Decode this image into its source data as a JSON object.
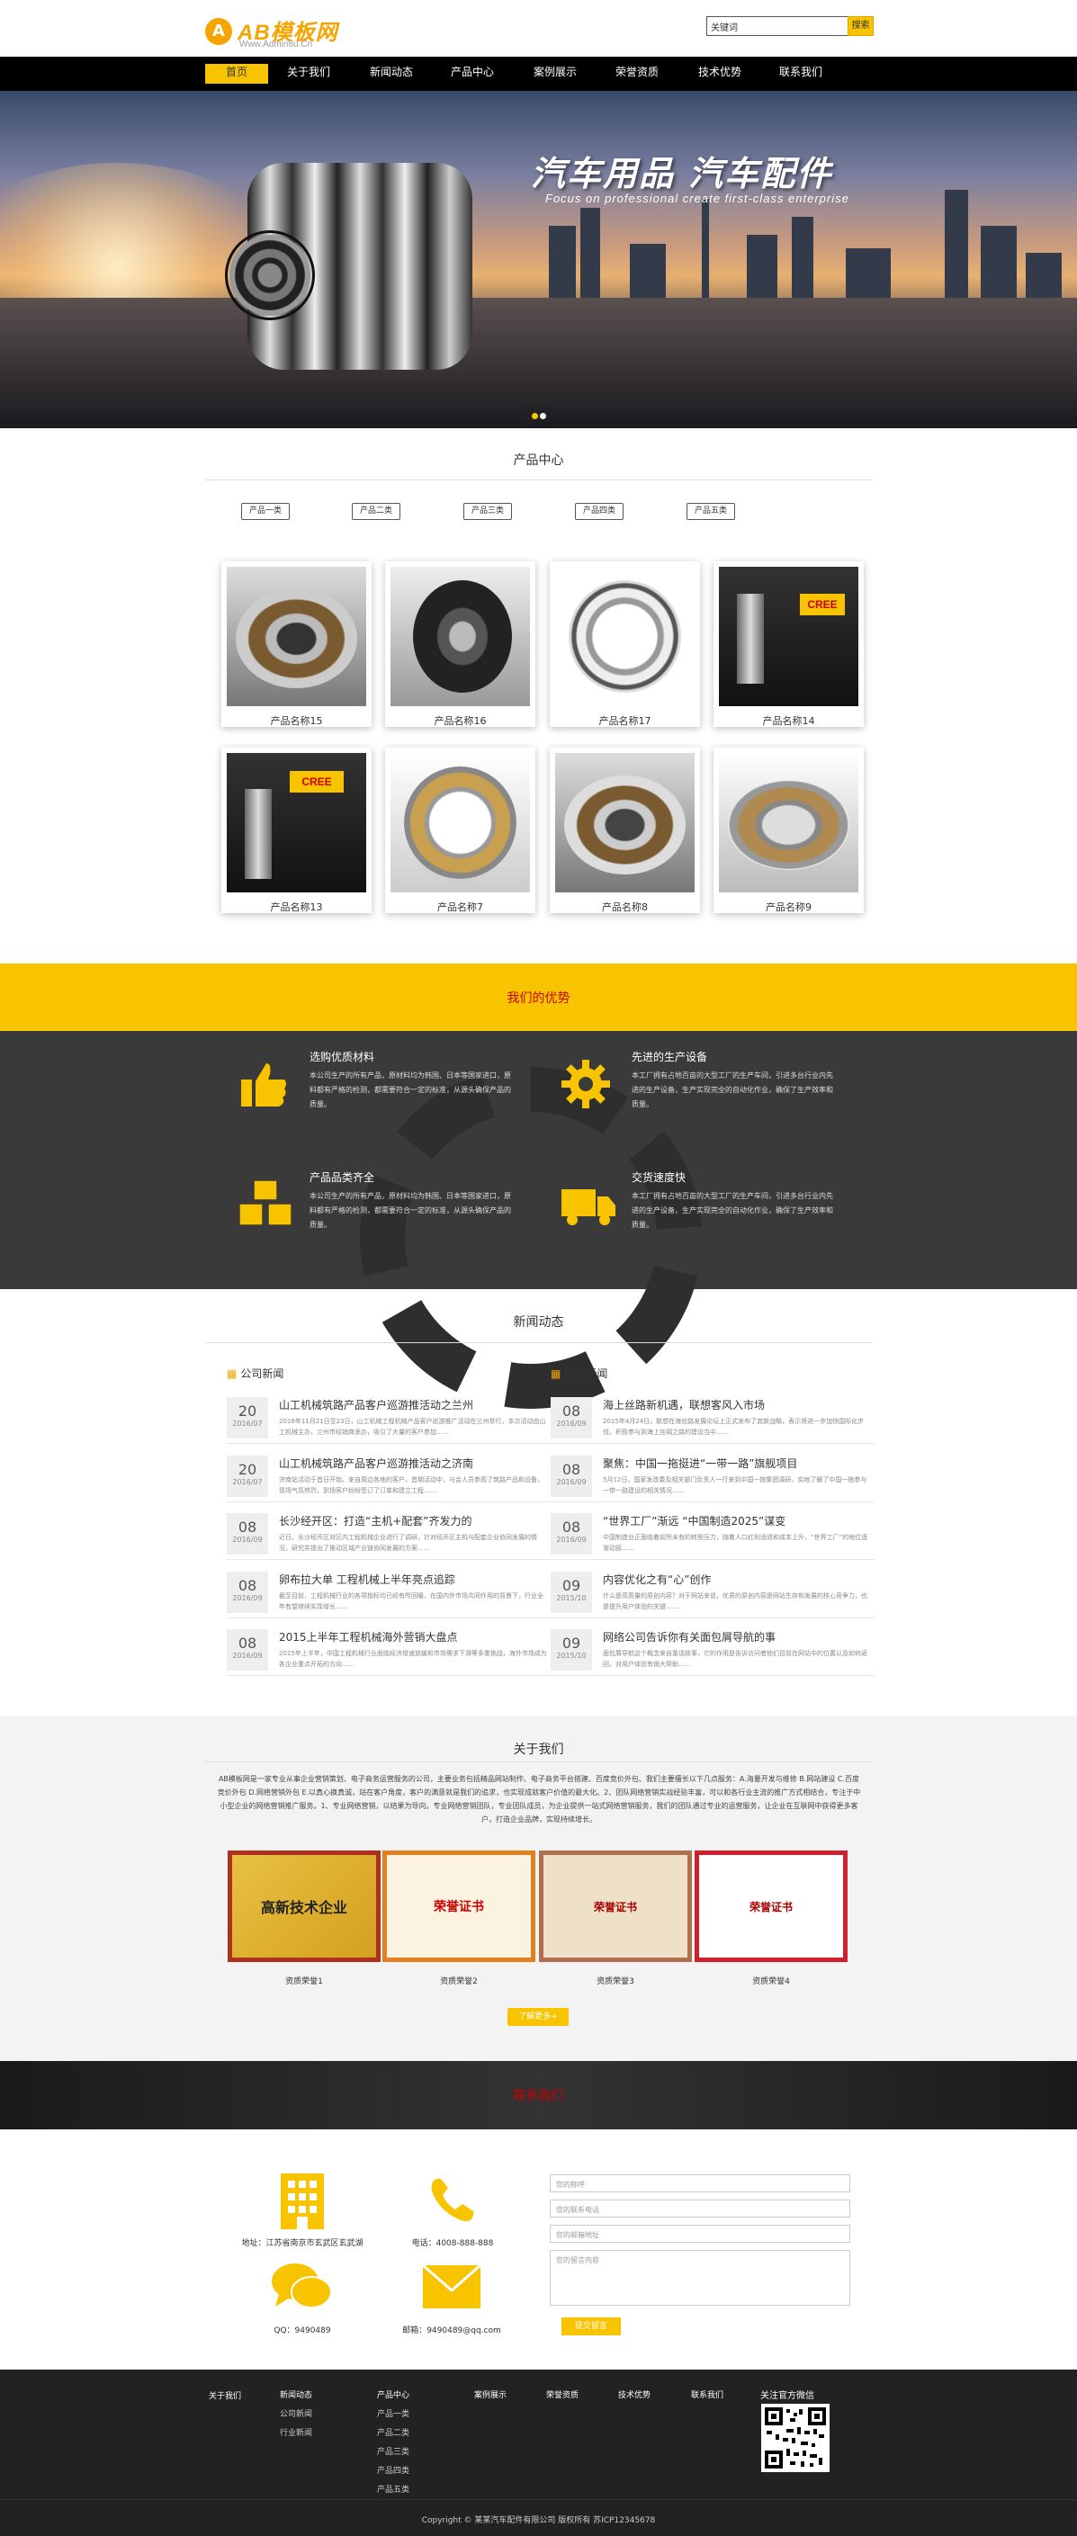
{
  "header": {
    "logo_mark": "A",
    "logo_name": "AB模板网",
    "logo_url": "Www.Admin8u.Cn",
    "search_placeholder": "关键词",
    "search_button": "搜索"
  },
  "nav": [
    "首页",
    "关于我们",
    "新闻动态",
    "产品中心",
    "案例展示",
    "荣誉资质",
    "技术优势",
    "联系我们"
  ],
  "banner": {
    "title": "汽车用品 汽车配件",
    "subtitle": "Focus on professional create first-class enterprise"
  },
  "products": {
    "title": "产品中心",
    "categories": [
      "产品一类",
      "产品二类",
      "产品三类",
      "产品四类",
      "产品五类"
    ],
    "items": [
      "产品名称15",
      "产品名称16",
      "产品名称17",
      "产品名称14",
      "产品名称13",
      "产品名称7",
      "产品名称8",
      "产品名称9"
    ]
  },
  "advantages": {
    "title": "我们的优势",
    "items": [
      {
        "title": "选购优质材料",
        "text": "本公司生产的所有产品，原材料均为韩国、日本等国家进口，原料都有严格的检测，都需要符合一定的标准，从源头确保产品的质量。",
        "icon": "thumbs-up-icon"
      },
      {
        "title": "先进的生产设备",
        "text": "本工厂拥有占地百亩的大型工厂的生产车间，引进多台行业内先进的生产设备，生产实现完全的自动化作业，确保了生产效率和质量。",
        "icon": "gear-icon"
      },
      {
        "title": "产品品类齐全",
        "text": "本公司生产的所有产品，原材料均为韩国、日本等国家进口，原料都有严格的检测，都需要符合一定的标准，从源头确保产品的质量。",
        "icon": "boxes-icon"
      },
      {
        "title": "交货速度快",
        "text": "本工厂拥有占地百亩的大型工厂的生产车间，引进多台行业内先进的生产设备，生产实现完全的自动化作业，确保了生产效率和质量。",
        "icon": "truck-icon"
      }
    ]
  },
  "news": {
    "title": "新闻动态",
    "company_title": "公司新闻",
    "industry_title": "行业新闻",
    "company": [
      {
        "day": "20",
        "ym": "2016/07",
        "title": "山工机械筑路产品客户巡游推活动之兰州",
        "summary": "2016年11月21日至23日，山工机械工程机械产品客户巡游推广活动在兰州举行，本次活动由山工机械主办，兰州市经销商承办，吸引了大量的客户参加……"
      },
      {
        "day": "20",
        "ym": "2016/07",
        "title": "山工机械筑路产品客户巡游推活动之济南",
        "summary": "济南站活动于首日开始，来自周边各地的客户，首期活动中，与会人员参观了筑路产品和设备，现场气氛热烈，到场客户纷纷签订了订单和建立工程……"
      },
      {
        "day": "08",
        "ym": "2016/09",
        "title": "长沙经开区：打造“主机+配套”齐发力的",
        "summary": "近日，长沙经开区对区内工程机械企业进行了调研，针对经开区主机与配套企业协同发展的情况，研究并提出了推动区域产业链协同发展的方案……"
      },
      {
        "day": "08",
        "ym": "2016/09",
        "title": "卵布拉大单 工程机械上半年亮点追踪",
        "summary": "截至目前，工程机械行业的各项指标均已经有所回暖，在国内外市场共同作用的背景下，行业全年有望继续实现增长……"
      },
      {
        "day": "08",
        "ym": "2016/09",
        "title": "2015上半年工程机械海外营销大盘点",
        "summary": "2015年上半年，中国工程机械行业面临经济增速放缓和市场需求下滑等多重挑战，海外市场成为各企业重点开拓的方向……"
      }
    ],
    "industry": [
      {
        "day": "08",
        "ym": "2016/09",
        "title": "海上丝路新机遇，联想客风入市场",
        "summary": "2015年4月24日，联想在海丝路发展论坛上正式发布了其新战略，表示将进一步加快国际化步伐，积极参与到海上丝绸之路的建设当中……"
      },
      {
        "day": "08",
        "ym": "2016/09",
        "title": "聚焦：中国一拖挺进“一带一路”旗舰项目",
        "summary": "5月12日，国家发改委及相关部门负责人一行来到中国一拖集团调研，实地了解了中国一拖参与一带一路建设的相关情况……"
      },
      {
        "day": "08",
        "ym": "2016/09",
        "title": "“世界工厂”渐远 “中国制造2025”谋变",
        "summary": "中国制造业正面临着前所未有的转型压力，随着人口红利消退和成本上升，“世界工厂”的地位逐渐动摇……"
      },
      {
        "day": "09",
        "ym": "2015/10",
        "title": "内容优化之有“心”创作",
        "summary": "什么是高质量的原创内容？对于网站来说，优质的原创内容是网站生存和发展的核心竞争力，也是提升用户体验的关键……"
      },
      {
        "day": "09",
        "ym": "2015/10",
        "title": "网络公司告诉你有关面包屑导航的事",
        "summary": "面包屑导航这个概念来自童话故事，它的作用是告诉访问者他们目前在网站中的位置以及如何返回，对用户体验有很大帮助……"
      }
    ]
  },
  "about": {
    "title": "关于我们",
    "text": "AB模板网是一家专业从事企业营销策划、电子商务运营服务的公司，主要业务包括精品网站制作、电子商务平台搭建、百度竞价外包、我们主要擅长以下几点服务：A.海量开发与维修 B.网站建设 C.百度竞价外包 D.网络营销外包 E.以真心换真诚，站在客户角度，客户的满意就是我们的追求，也实现成就客户价值的最大化。2、团队网络营销实战经验丰富，可以和各行业主流的推广方式相结合，专注于中小型企业的网络营销推广服务。1、专业网络营销，以结果为导向。专业网络营销团队，专业团队成员，为企业提供一站式网络营销服务，我们的团队通过专业的运营服务，让企业在互联网中获得更多客户，打造企业品牌，实现持续增长。",
    "certs": [
      "资质荣誉1",
      "资质荣誉2",
      "资质荣誉3",
      "资质荣誉4"
    ],
    "cert_texts": [
      "高新技术企业",
      "荣誉证书",
      "荣誉证书",
      "荣誉证书"
    ],
    "more_button": "了解更多+"
  },
  "contact": {
    "title": "联系我们",
    "address": "地址：江苏省南京市玄武区玄武湖",
    "phone": "电话：4008-888-888",
    "qq": "QQ：9490489",
    "email": "邮箱：9490489@qq.com",
    "form": {
      "name": "您的称呼",
      "phone": "您的联系电话",
      "email": "您的邮箱地址",
      "message": "您的留言内容",
      "submit": "提交留言"
    }
  },
  "footer": {
    "columns": [
      {
        "head": "关于我们",
        "links": []
      },
      {
        "head": "新闻动态",
        "links": [
          "公司新闻",
          "行业新闻"
        ]
      },
      {
        "head": "产品中心",
        "links": [
          "产品一类",
          "产品二类",
          "产品三类",
          "产品四类",
          "产品五类"
        ]
      },
      {
        "head": "案例展示",
        "links": []
      },
      {
        "head": "荣誉资质",
        "links": []
      },
      {
        "head": "技术优势",
        "links": []
      },
      {
        "head": "联系我们",
        "links": []
      }
    ],
    "qr_title": "关注官方微信",
    "copyright": "Copyright © 某某汽车配件有限公司 版权所有   苏ICP12345678"
  },
  "colors": {
    "accent": "#f8c400",
    "dark": "#3a3a3a",
    "title_red": "#cc0000"
  }
}
